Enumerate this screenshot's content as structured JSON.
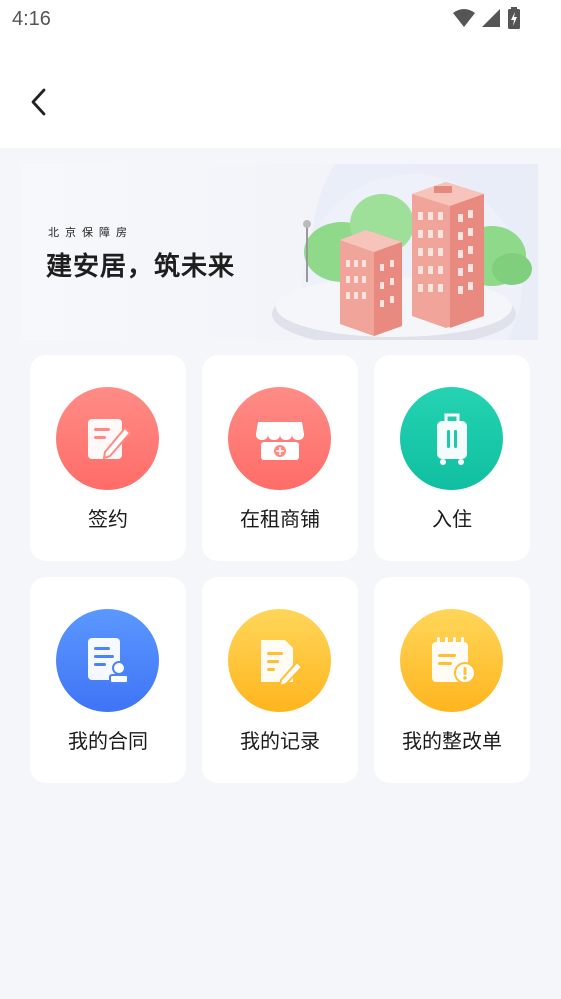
{
  "status_bar": {
    "time": "4:16"
  },
  "nav": {
    "back_icon": "chevron-left-icon"
  },
  "banner": {
    "subtitle": "北京保障房",
    "title": "建安居，筑未来"
  },
  "services": [
    {
      "label": "签约",
      "icon": "sign-icon",
      "color": "#ff7a74"
    },
    {
      "label": "在租商铺",
      "icon": "shop-icon",
      "color": "#ff7a74"
    },
    {
      "label": "入住",
      "icon": "luggage-icon",
      "color": "#1cc9a8"
    },
    {
      "label": "我的合同",
      "icon": "contract-icon",
      "color": "#4a84fa"
    },
    {
      "label": "我的记录",
      "icon": "record-icon",
      "color": "#ffc43a"
    },
    {
      "label": "我的整改单",
      "icon": "rectification-icon",
      "color": "#ffc43a"
    }
  ]
}
